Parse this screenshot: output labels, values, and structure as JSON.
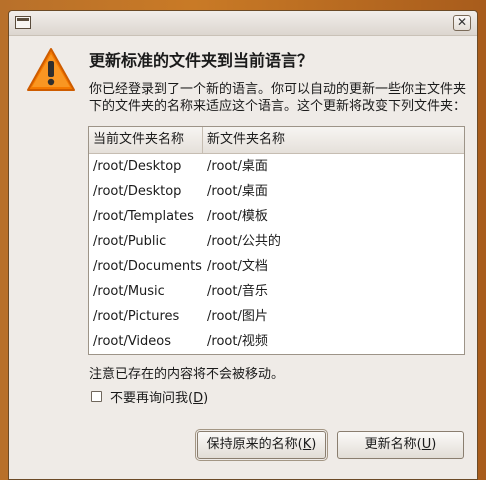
{
  "window": {
    "menu_icon": "window-menu-icon",
    "close_glyph": "✕"
  },
  "dialog": {
    "icon": "warning-icon",
    "title": "更新标准的文件夹到当前语言？",
    "description": "你已经登录到了一个新的语言。你可以自动的更新一些你主文件夹下的文件夹的名称来适应这个语言。这个更新将改变下列文件夹：",
    "table": {
      "columns": [
        "当前文件夹名称",
        "新文件夹名称"
      ],
      "rows": [
        [
          "/root/Desktop",
          "/root/桌面"
        ],
        [
          "/root/Desktop",
          "/root/桌面"
        ],
        [
          "/root/Templates",
          "/root/模板"
        ],
        [
          "/root/Public",
          "/root/公共的"
        ],
        [
          "/root/Documents",
          "/root/文档"
        ],
        [
          "/root/Music",
          "/root/音乐"
        ],
        [
          "/root/Pictures",
          "/root/图片"
        ],
        [
          "/root/Videos",
          "/root/视频"
        ]
      ]
    },
    "note": "注意已存在的内容将不会被移动。",
    "checkbox": {
      "label_prefix": "不要再询问我(",
      "mnemonic": "D",
      "label_suffix": ")",
      "checked": false
    },
    "buttons": {
      "keep": {
        "prefix": "保持原来的名称(",
        "mnemonic": "K",
        "suffix": ")"
      },
      "update": {
        "prefix": "更新名称(",
        "mnemonic": "U",
        "suffix": ")"
      }
    }
  },
  "colors": {
    "desktop": "#c97a26",
    "dialog_bg": "#efebe7",
    "warning_fill": "#f57900"
  }
}
